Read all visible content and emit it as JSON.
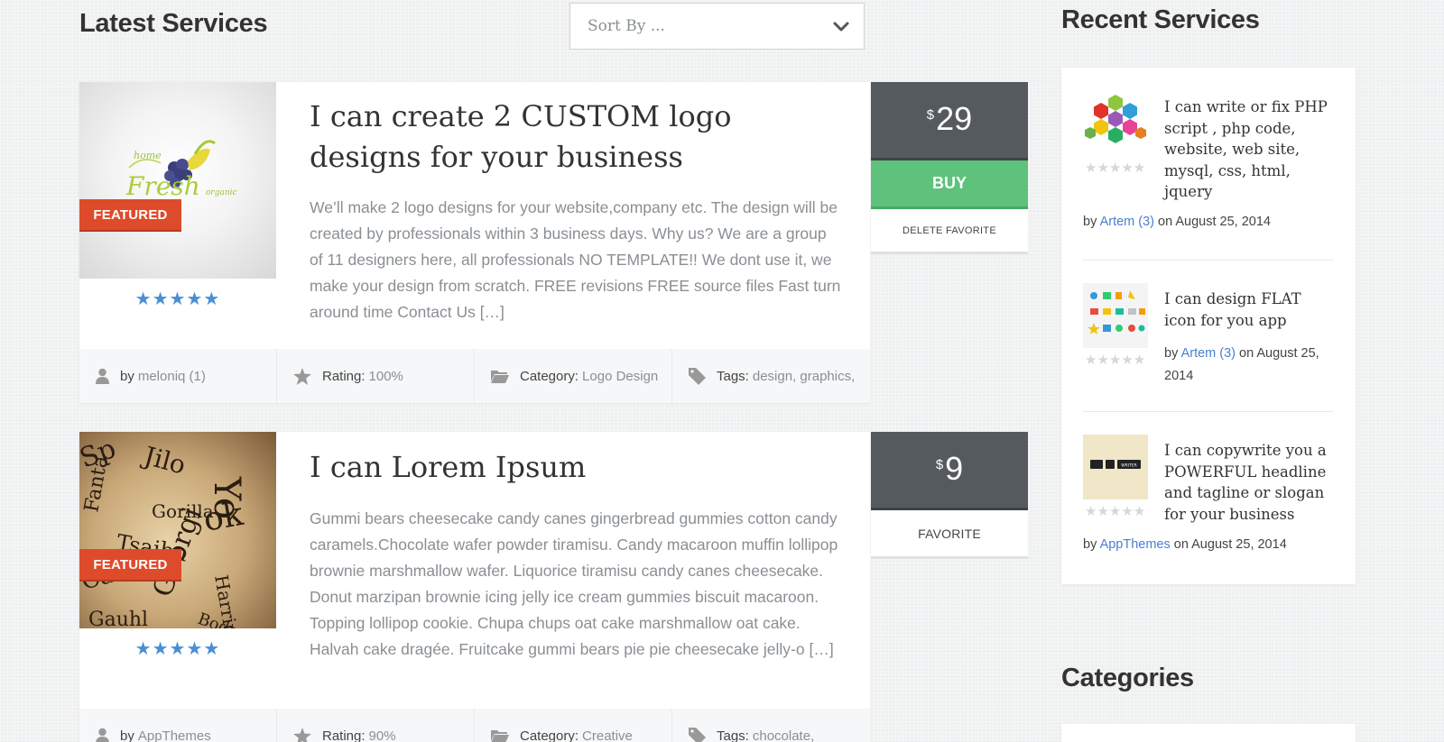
{
  "header": {
    "title": "Latest Services",
    "sort_placeholder": "Sort By ..."
  },
  "services": [
    {
      "badge": "FEATURED",
      "stars": "★★★★★",
      "title": "I can create 2 CUSTOM logo designs for your business",
      "description": "We’ll make 2 logo designs for your website,company etc. The design will be created by professionals within 3 business days.   Why us? We are a group of 11 designers here, all professionals NO TEMPLATE!! We dont use it, we make your design from scratch. FREE revisions FREE source files Fast turn around time Contact Us […]",
      "by_label": "by",
      "author": "meloniq (1)",
      "rating_label": "Rating:",
      "rating": "100%",
      "category_label": "Category:",
      "category": "Logo Design",
      "tags_label": "Tags:",
      "tags": "design, graphics,",
      "price_currency": "$",
      "price": "29",
      "buy_label": "BUY",
      "favorite_label": "DELETE FAVORITE",
      "thumb_text": "Fresh"
    },
    {
      "badge": "FEATURED",
      "stars": "★★★★★",
      "title": "I can Lorem Ipsum",
      "description": "Gummi bears cheesecake candy canes gingerbread gummies cotton candy caramels.Chocolate wafer powder tiramisu. Candy macaroon muffin lollipop brownie marshmallow wafer. Liquorice tiramisu candy canes cheesecake. Donut marzipan brownie icing jelly ice cream gummies biscuit macaroon. Topping lollipop cookie. Chupa chups oat cake marshmallow oat cake. Halvah cake dragée. Fruitcake gummi bears pie pie cheesecake jelly-o […]",
      "by_label": "by",
      "author": "AppThemes",
      "rating_label": "Rating:",
      "rating": "90%",
      "category_label": "Category:",
      "category": "Creative",
      "tags_label": "Tags:",
      "tags": "chocolate,",
      "price_currency": "$",
      "price": "9",
      "favorite_label": "FAVORITE"
    }
  ],
  "sidebar": {
    "recent_title": "Recent Services",
    "recent": [
      {
        "title": "I can write or fix PHP script , php code, website, web site, mysql, css, html, jquery",
        "stars": "★★★★★",
        "by": "by",
        "author": "Artem (3)",
        "on": "on August 25, 2014"
      },
      {
        "title": "I can design FLAT icon for you app",
        "stars": "★★★★★",
        "by": "by",
        "author": "Artem (3)",
        "on": "on August 25, 2014"
      },
      {
        "title": "I can copywrite you a POWERFUL headline and tagline or slogan for your business",
        "stars": "★★★★★",
        "by": "by",
        "author": "AppThemes",
        "on": " on August 25, 2014",
        "thumb_label": "WRITER"
      }
    ],
    "categories_title": "Categories"
  },
  "colors": {
    "featured": "#de4b2b",
    "buy": "#5ec17c",
    "price_bg": "#555a5e",
    "link": "#4a7fcf",
    "star": "#4a8fd3"
  }
}
